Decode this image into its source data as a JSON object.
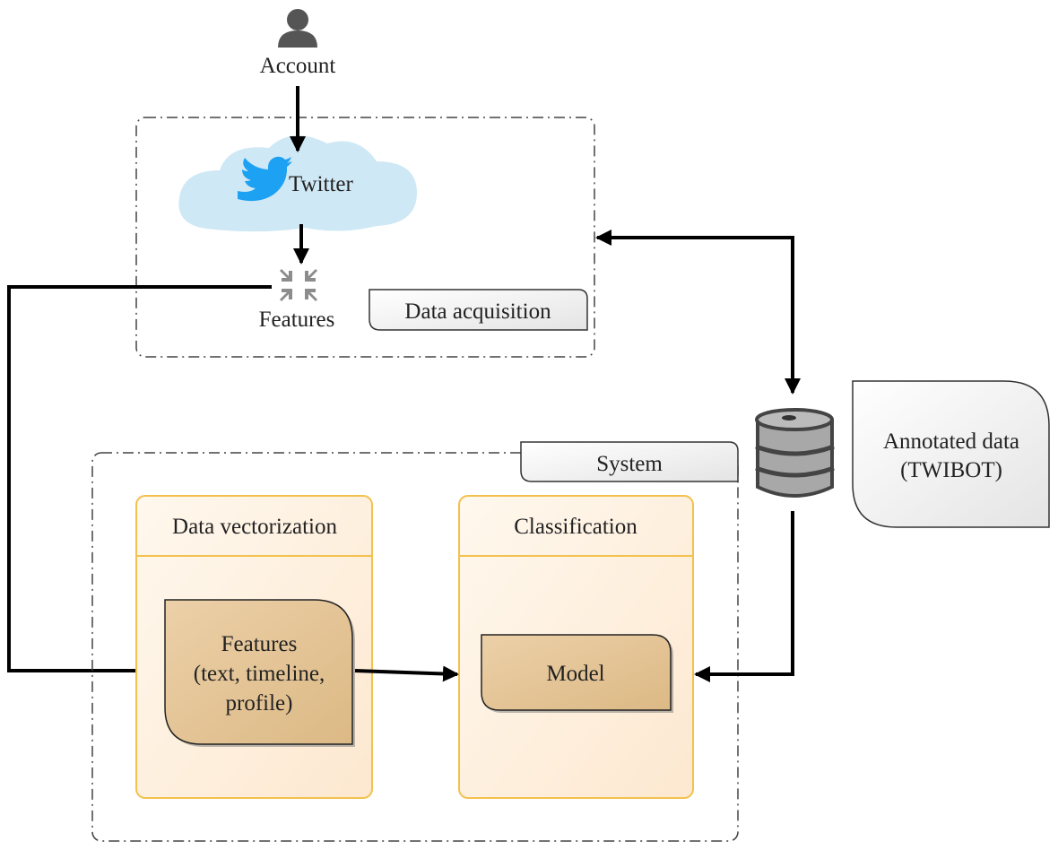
{
  "nodes": {
    "account": {
      "label": "Account",
      "icon": "user-icon"
    },
    "twitter": {
      "label": "Twitter",
      "icon": "twitter-bird-icon"
    },
    "features_source": {
      "label": "Features",
      "icon": "collapse-arrows-icon"
    },
    "data_acquisition": {
      "label": "Data acquisition"
    },
    "database": {
      "icon": "database-barrel-icon"
    },
    "annotated_data": {
      "line1": "Annotated data",
      "line2": "(TWIBOT)"
    },
    "system": {
      "label": "System"
    },
    "data_vectorization": {
      "label": "Data vectorization"
    },
    "features_box": {
      "line1": "Features",
      "line2": "(text, timeline,",
      "line3": "profile)"
    },
    "classification": {
      "label": "Classification"
    },
    "model": {
      "label": "Model"
    }
  },
  "colors": {
    "cloud": "#cfe8f5",
    "twitter_blue": "#1da1f2",
    "lane_border": "#f2c14e",
    "lane_fill": "#fff3e3",
    "box_fill": "#e7c99d",
    "icon_gray": "#8c8c8c"
  }
}
